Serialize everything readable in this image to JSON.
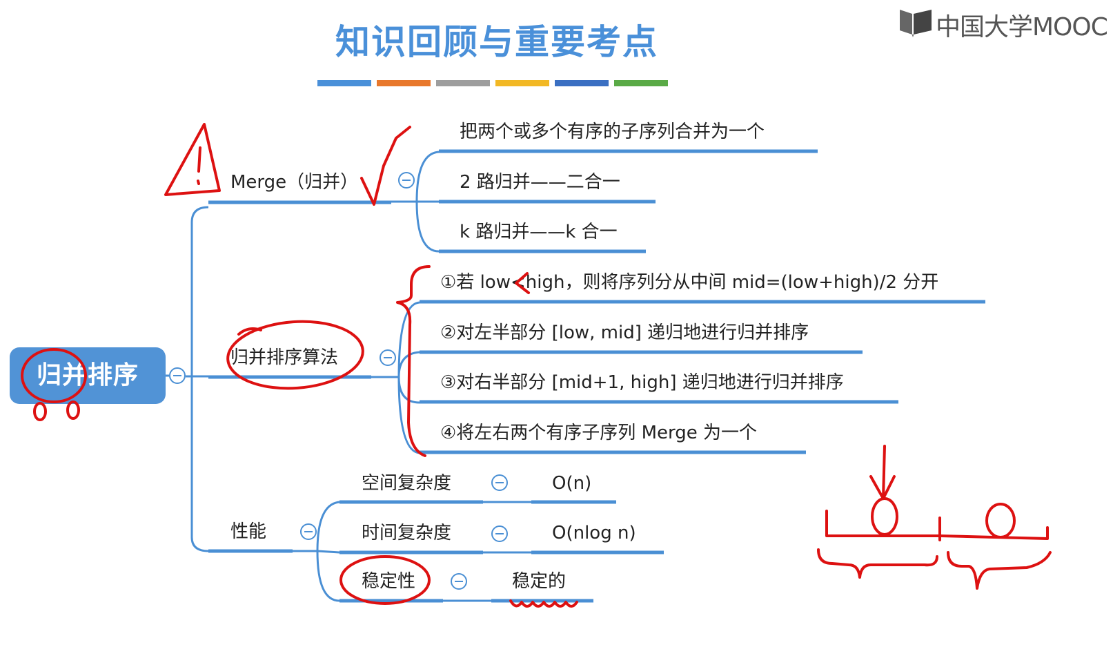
{
  "header": {
    "title": "知识回顾与重要考点",
    "stripe_colors": [
      "#4a90d9",
      "#e8782c",
      "#9e9e9e",
      "#f2b824",
      "#3a6fc2",
      "#5aaa46"
    ]
  },
  "brand": {
    "name": "中国大学MOOC"
  },
  "colors": {
    "node": "#5193d6",
    "line": "#4a8fd4",
    "ink": "#dd1111"
  },
  "mindmap": {
    "root": {
      "label": "归并排序"
    },
    "merge": {
      "label": "Merge（归并）",
      "children": [
        "把两个或多个有序的子序列合并为一个",
        "2 路归并——二合一",
        "k 路归并——k 合一"
      ]
    },
    "algorithm": {
      "label": "归并排序算法",
      "steps": [
        "①若 low<high，则将序列分从中间 mid=(low+high)/2 分开",
        "②对左半部分 [low, mid] 递归地进行归并排序",
        "③对右半部分 [mid+1, high] 递归地进行归并排序",
        "④将左右两个有序子序列 Merge 为一个"
      ]
    },
    "performance": {
      "label": "性能",
      "items": [
        {
          "label": "空间复杂度",
          "value": "O(n)"
        },
        {
          "label": "时间复杂度",
          "value": "O(nlog n)"
        },
        {
          "label": "稳定性",
          "value": "稳定的"
        }
      ]
    }
  },
  "icons": {
    "collapse": "collapse-minus-icon",
    "brand": "mooc-book-icon"
  }
}
